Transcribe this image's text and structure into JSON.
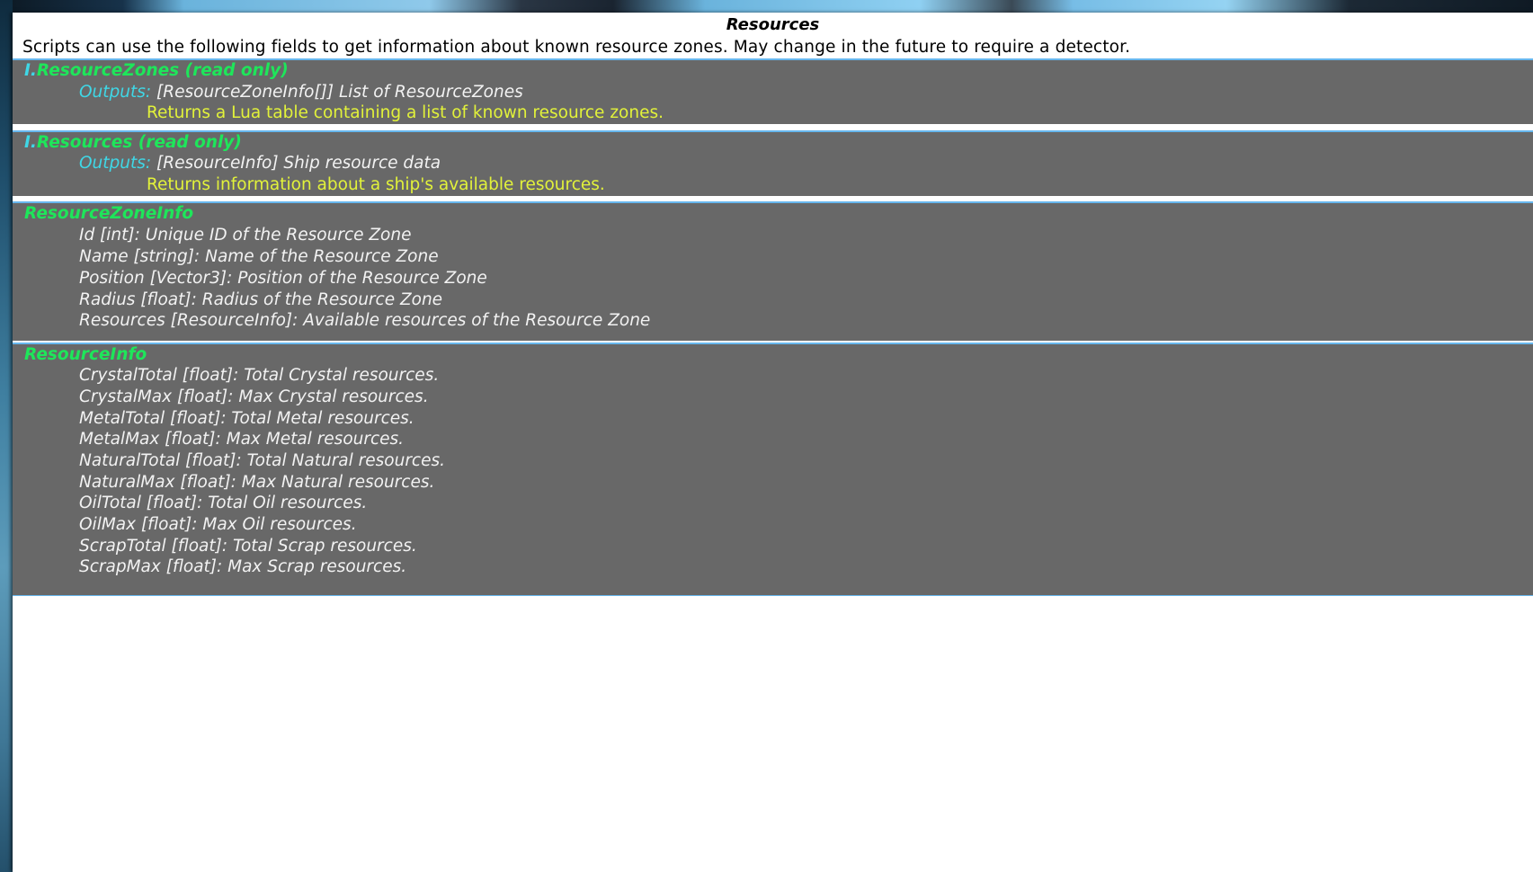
{
  "window": {
    "title": "Resources",
    "intro": "Scripts can use the following fields to get information about known resource zones.  May change in the future to require a detector."
  },
  "sections": {
    "resource_zones": {
      "roman": "I.",
      "header": "ResourceZones (read only)",
      "outputs_label": "Outputs:",
      "outputs_value": "[ResourceZoneInfo[]] List of ResourceZones",
      "description": "Returns a Lua table containing a list of known resource zones."
    },
    "resources": {
      "roman": "I.",
      "header": "Resources (read only)",
      "outputs_label": "Outputs:",
      "outputs_value": "[ResourceInfo] Ship resource data",
      "description": "Returns information about a ship's available resources."
    },
    "resource_zone_info": {
      "header": "ResourceZoneInfo",
      "fields": [
        "Id [int]: Unique ID of the Resource Zone",
        "Name [string]: Name of the Resource Zone",
        "Position [Vector3]: Position of the Resource Zone",
        "Radius [float]: Radius of the Resource Zone",
        "Resources [ResourceInfo]: Available resources of the Resource Zone"
      ]
    },
    "resource_info": {
      "header": "ResourceInfo",
      "fields": [
        "CrystalTotal [float]: Total Crystal resources.",
        "CrystalMax [float]: Max Crystal resources.",
        "MetalTotal [float]: Total Metal resources.",
        "MetalMax [float]: Max Metal resources.",
        "NaturalTotal [float]: Total Natural resources.",
        "NaturalMax [float]: Max Natural resources.",
        "OilTotal [float]: Total Oil resources.",
        "OilMax [float]: Max Oil resources.",
        "ScrapTotal [float]: Total Scrap resources.",
        "ScrapMax [float]: Max Scrap resources."
      ]
    }
  },
  "colors": {
    "section_bg": "#686868",
    "header_green": "#1ee65a",
    "cyan": "#3fd7e6",
    "description_yellow": "#e2f23a",
    "separator_blue": "#67b7ee"
  }
}
